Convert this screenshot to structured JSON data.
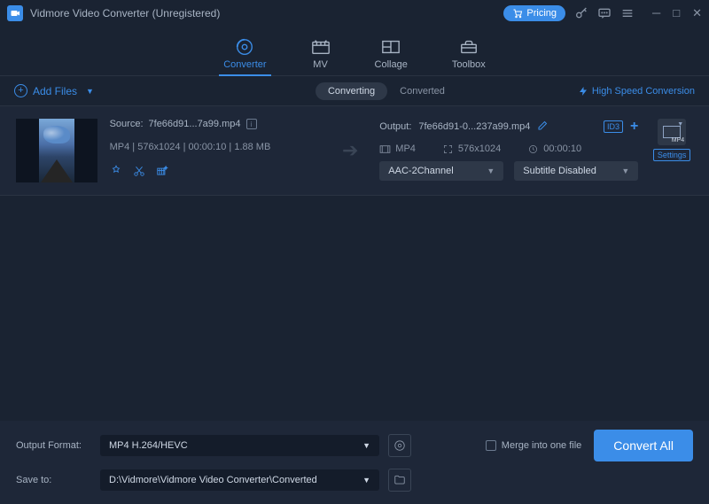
{
  "titlebar": {
    "app_title": "Vidmore Video Converter (Unregistered)",
    "pricing": "Pricing"
  },
  "top_tabs": {
    "converter": "Converter",
    "mv": "MV",
    "collage": "Collage",
    "toolbox": "Toolbox"
  },
  "toolbar": {
    "add_files": "Add Files",
    "converting": "Converting",
    "converted": "Converted",
    "high_speed": "High Speed Conversion"
  },
  "file": {
    "source_label": "Source:",
    "source_name": "7fe66d91...7a99.mp4",
    "container": "MP4",
    "resolution": "576x1024",
    "duration": "00:00:10",
    "size": "1.88 MB",
    "output_label": "Output:",
    "output_name": "7fe66d91-0...237a99.mp4",
    "out_container": "MP4",
    "out_resolution": "576x1024",
    "out_duration": "00:00:10",
    "audio": "AAC-2Channel",
    "subtitle": "Subtitle Disabled",
    "fmt_tag": "MP4",
    "settings": "Settings"
  },
  "footer": {
    "output_format_label": "Output Format:",
    "output_format_value": "MP4 H.264/HEVC",
    "save_to_label": "Save to:",
    "save_to_value": "D:\\Vidmore\\Vidmore Video Converter\\Converted",
    "merge": "Merge into one file",
    "convert": "Convert All"
  }
}
